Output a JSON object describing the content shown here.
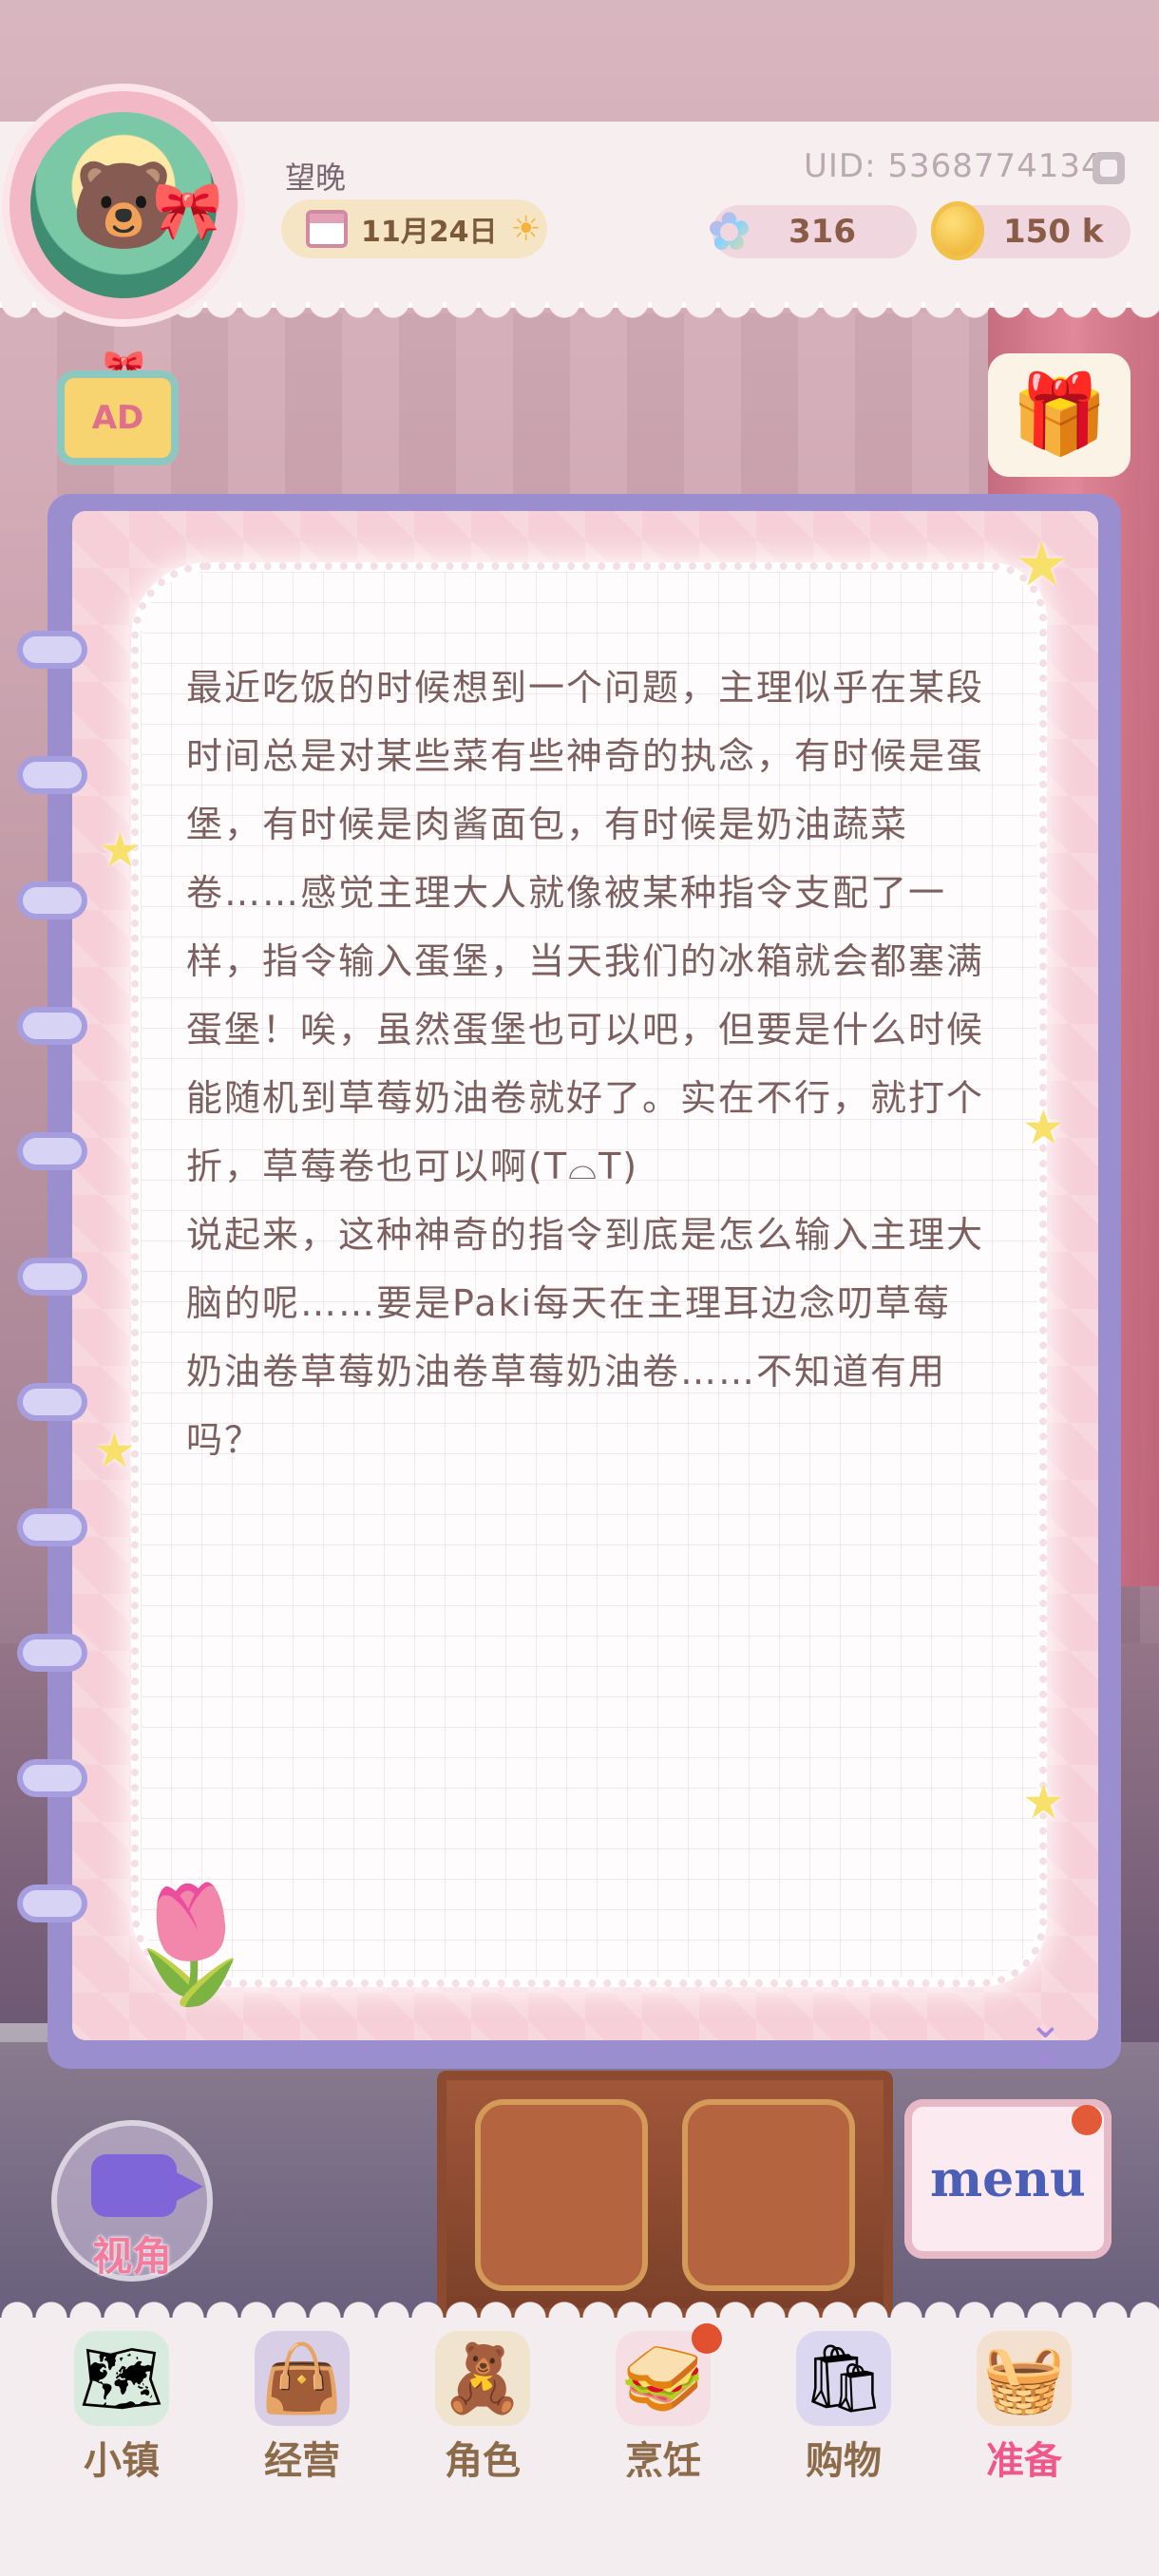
{
  "profile": {
    "username": "望晚",
    "date": "11月24日",
    "uid": "UID: 5368774134"
  },
  "currency": {
    "gems": "316",
    "coins": "150 k"
  },
  "buttons": {
    "ad_label": "AD",
    "view_label": "视角",
    "menu_label": "menu"
  },
  "note": {
    "text": "最近吃饭的时候想到一个问题，主理似乎在某段时间总是对某些菜有些神奇的执念，有时候是蛋堡，有时候是肉酱面包，有时候是奶油蔬菜卷……感觉主理大人就像被某种指令支配了一样，指令输入蛋堡，当天我们的冰箱就会都塞满蛋堡！唉，虽然蛋堡也可以吧，但要是什么时候能随机到草莓奶油卷就好了。实在不行，就打个折，草莓卷也可以啊(T⌓T)\n说起来，这种神奇的指令到底是怎么输入主理大脑的呢……要是Paki每天在主理耳边念叨草莓奶油卷草莓奶油卷草莓奶油卷……不知道有用吗？"
  },
  "bottom_nav": [
    {
      "label": "小镇",
      "icon": "map-icon",
      "active": false,
      "badge": false
    },
    {
      "label": "经营",
      "icon": "bag-lock-icon",
      "active": false,
      "badge": false
    },
    {
      "label": "角色",
      "icon": "character-icon",
      "active": false,
      "badge": false
    },
    {
      "label": "烹饪",
      "icon": "sandwich-icon",
      "active": false,
      "badge": true
    },
    {
      "label": "购物",
      "icon": "shopping-bag-icon",
      "active": false,
      "badge": false
    },
    {
      "label": "准备",
      "icon": "basket-icon",
      "active": true,
      "badge": false
    }
  ],
  "colors": {
    "accent_pink": "#f0588c",
    "notebook_purple": "#9a8ecf",
    "text_brown": "#7c5f5f",
    "badge_red": "#e1502f"
  }
}
